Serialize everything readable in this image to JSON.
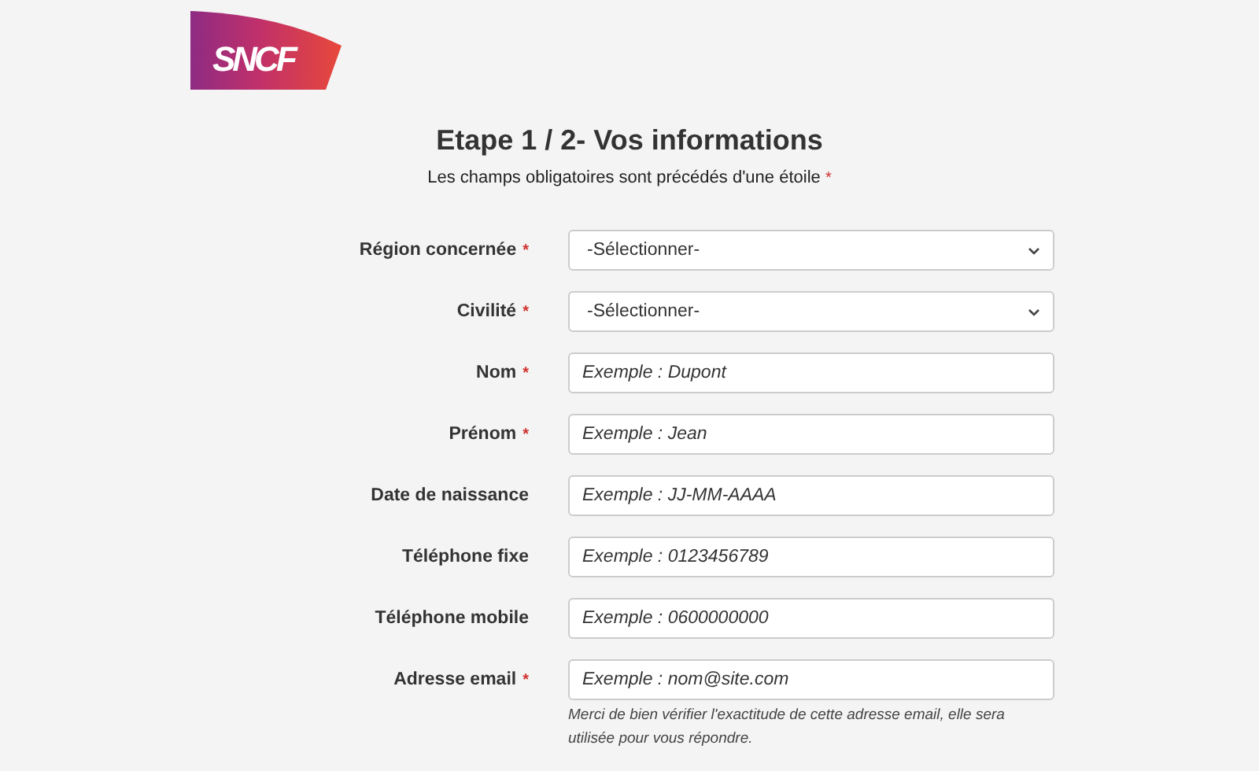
{
  "logo": {
    "text": "SNCF"
  },
  "title": "Etape 1 / 2- Vos informations",
  "subtitle": "Les champs obligatoires sont précédés d'une étoile",
  "required_mark": "*",
  "fields": [
    {
      "kind": "select",
      "label": "Région concernée",
      "required": true,
      "value": "-Sélectionner-"
    },
    {
      "kind": "select",
      "label": "Civilité",
      "required": true,
      "value": "-Sélectionner-"
    },
    {
      "kind": "input",
      "label": "Nom",
      "required": true,
      "placeholder": "Exemple : Dupont"
    },
    {
      "kind": "input",
      "label": "Prénom",
      "required": true,
      "placeholder": "Exemple : Jean"
    },
    {
      "kind": "input",
      "label": "Date de naissance",
      "required": false,
      "placeholder": "Exemple : JJ-MM-AAAA"
    },
    {
      "kind": "input",
      "label": "Téléphone fixe",
      "required": false,
      "placeholder": "Exemple : 0123456789"
    },
    {
      "kind": "input",
      "label": "Téléphone mobile",
      "required": false,
      "placeholder": "Exemple : 0600000000"
    },
    {
      "kind": "input",
      "label": "Adresse email",
      "required": true,
      "placeholder": "Exemple : nom@site.com",
      "help": "Merci de bien vérifier l'exactitude de cette adresse email, elle sera utilisée pour vous répondre."
    }
  ]
}
